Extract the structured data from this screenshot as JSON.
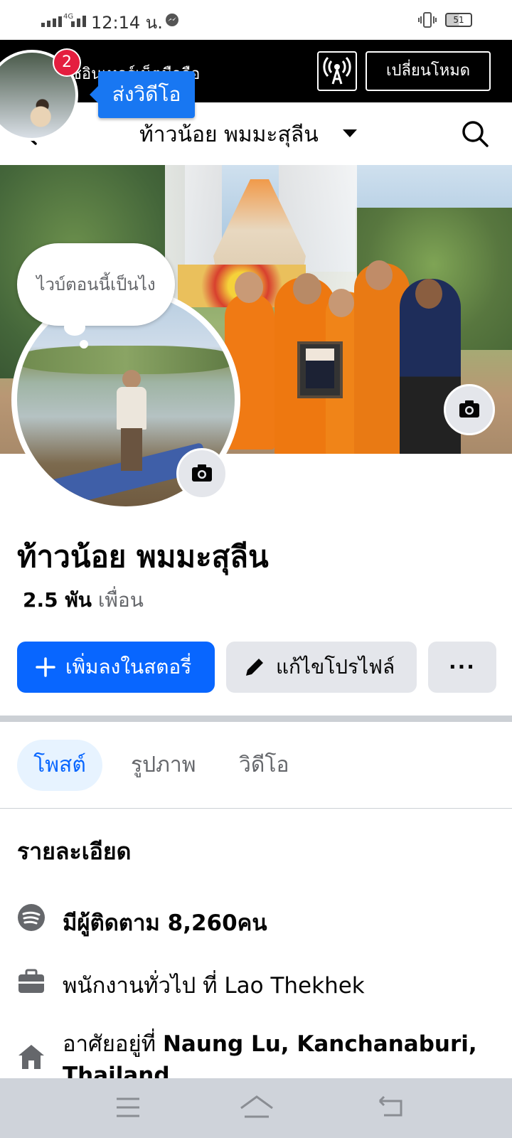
{
  "status_bar": {
    "network": "4G",
    "time": "12:14 น.",
    "battery": "51"
  },
  "banner": {
    "text": "ชอินเทอร์เน็ตมือถือ",
    "mode_button": "เปลี่ยนโหมด"
  },
  "chat_head": {
    "badge_count": "2",
    "tooltip": "ส่งวิดีโอ"
  },
  "header": {
    "title": "ท้าวน้อย พมมะสุลีน"
  },
  "note": {
    "text": "ไวบ์ตอนนี้เป็นไง"
  },
  "profile": {
    "name": "ท้าวน้อย พมมะสุลีน",
    "friend_count": "2.5 พัน",
    "friend_label": "เพื่อน"
  },
  "actions": {
    "add_story": "เพิ่มลงในสตอรี่",
    "edit_profile": "แก้ไขโปรไฟล์",
    "more": "···"
  },
  "tabs": [
    {
      "label": "โพสต์",
      "active": true
    },
    {
      "label": "รูปภาพ",
      "active": false
    },
    {
      "label": "วิดีโอ",
      "active": false
    }
  ],
  "details": {
    "heading": "รายละเอียด",
    "followers": "มีผู้ติดตาม 8,260คน",
    "work": "พนักงานทั่วไป ที่ Lao Thekhek",
    "lives_prefix": "อาศัยอยู่ที่ ",
    "lives_place": "Naung Lu, Kanchanaburi, Thailand"
  },
  "icons": {
    "follower": "podcast-icon",
    "work": "briefcase-icon",
    "home": "home-icon"
  },
  "colors": {
    "primary": "#0866ff",
    "badge": "#e41e3f",
    "tooltip": "#1877f2"
  }
}
